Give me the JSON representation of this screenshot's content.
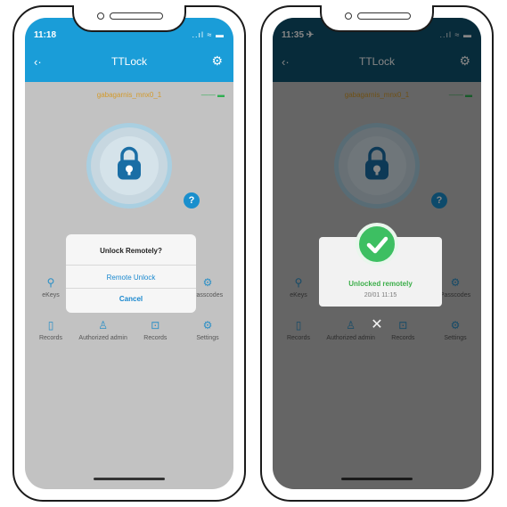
{
  "left_phone": {
    "status_time": "11:18",
    "status_icons": "..ıl ≈ ▬",
    "header_title": "TTLock",
    "lock_name": "gabagarnis_mnx0_1",
    "battery_text": "—— ▬",
    "help_label": "?",
    "features_row1": [
      "eKeys",
      "",
      "",
      "Passcodes"
    ],
    "features_row2": [
      "Records",
      "Authorized admin",
      "Records",
      "Settings"
    ],
    "dialog": {
      "title": "Unlock Remotely?",
      "option_remote": "Remote Unlock",
      "option_cancel": "Cancel"
    }
  },
  "right_phone": {
    "status_time": "11:35 ✈",
    "status_icons": "..ıl ≈ ▬",
    "header_title": "TTLock",
    "lock_name": "gabagarnis_mnx0_1",
    "battery_text": "—— ▬",
    "help_label": "?",
    "features_row1": [
      "eKeys",
      "",
      "",
      "Passcodes"
    ],
    "features_row2": [
      "Records",
      "Authorized admin",
      "Records",
      "Settings"
    ],
    "success": {
      "title": "Unlocked remotely",
      "time": "20/01 11:15"
    },
    "close_label": "✕"
  },
  "colors": {
    "header_blue": "#1a9dd8",
    "header_dim": "#0f5370",
    "success_green": "#3dbf62",
    "link_blue": "#1a88cf"
  },
  "icons": {
    "back": "back-arrow-icon",
    "settings": "gear-icon",
    "lock": "padlock-icon",
    "success": "checkmark-icon",
    "close": "close-icon"
  }
}
